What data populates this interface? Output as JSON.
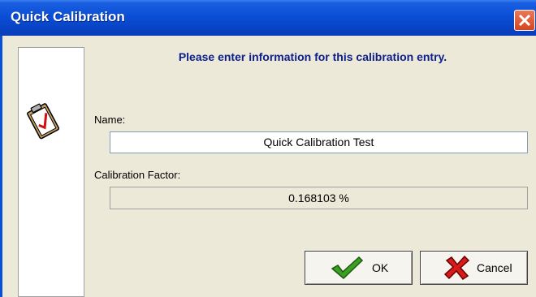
{
  "window": {
    "title": "Quick Calibration"
  },
  "dialog": {
    "heading": "Please enter information for this calibration entry.",
    "name_label": "Name:",
    "name_value": "Quick Calibration Test",
    "factor_label": "Calibration Factor:",
    "factor_value": "0.168103 %"
  },
  "buttons": {
    "ok": "OK",
    "cancel": "Cancel"
  },
  "icons": {
    "side": "clipboard-check-icon",
    "ok": "green-check-icon",
    "cancel": "red-x-icon",
    "close": "close-icon"
  }
}
